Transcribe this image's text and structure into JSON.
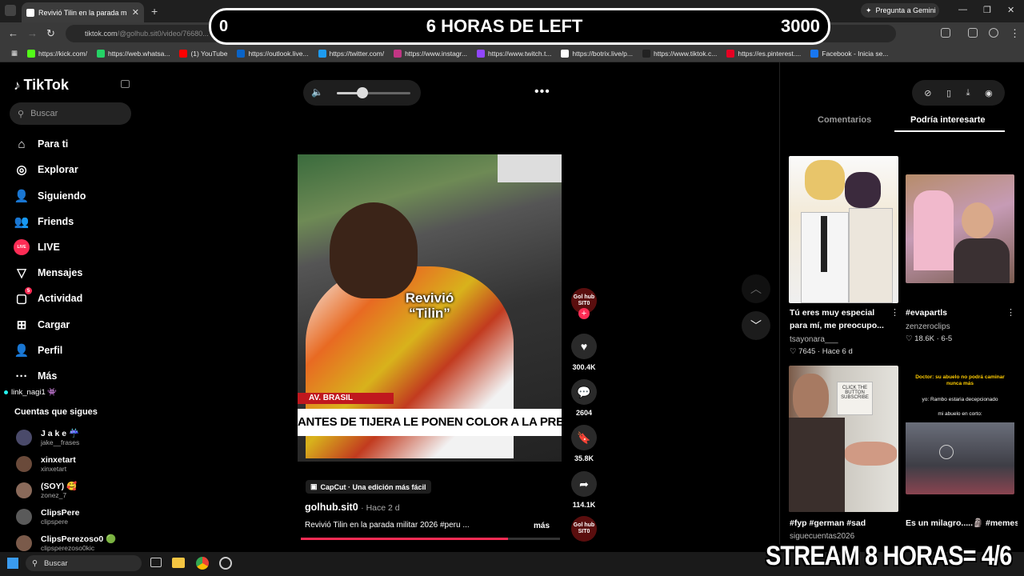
{
  "browser": {
    "tab_title": "Revivió Tilin en la parada m",
    "url_host": "tiktok.com",
    "url_path": "/@golhub.sit0/video/76680... 4600142083",
    "gemini": "Pregunta a Gemini",
    "bookmarks": [
      {
        "label": "https://kick.com/",
        "color": "#53fc18"
      },
      {
        "label": "https://web.whatsa...",
        "color": "#25d366"
      },
      {
        "label": "(1) YouTube",
        "color": "#ff0000"
      },
      {
        "label": "https://outlook.live...",
        "color": "#0a64c8"
      },
      {
        "label": "https://twitter.com/",
        "color": "#1d9bf0"
      },
      {
        "label": "https://www.instagr...",
        "color": "#c13584"
      },
      {
        "label": "https://www.twitch.t...",
        "color": "#9146ff"
      },
      {
        "label": "https://botrix.live/p...",
        "color": "#ffffff"
      },
      {
        "label": "https://www.tiktok.c...",
        "color": "#222222"
      },
      {
        "label": "https://es.pinterest....",
        "color": "#e60023"
      },
      {
        "label": "Facebook - Inicia se...",
        "color": "#1877f2"
      }
    ]
  },
  "overlay": {
    "left": "0",
    "center": "6 HORAS DE LEFT",
    "right": "3000"
  },
  "sidebar": {
    "logo": "TikTok",
    "search_placeholder": "Buscar",
    "nav": [
      {
        "label": "Para ti",
        "icon": "home-icon"
      },
      {
        "label": "Explorar",
        "icon": "compass-icon"
      },
      {
        "label": "Siguiendo",
        "icon": "following-icon"
      },
      {
        "label": "Friends",
        "icon": "friends-icon"
      },
      {
        "label": "LIVE",
        "icon": "live-icon"
      },
      {
        "label": "Mensajes",
        "icon": "messages-icon"
      },
      {
        "label": "Actividad",
        "icon": "activity-icon",
        "badge": "5"
      },
      {
        "label": "Cargar",
        "icon": "upload-icon"
      },
      {
        "label": "Perfil",
        "icon": "profile-icon"
      },
      {
        "label": "Más",
        "icon": "more-icon"
      }
    ],
    "live_user": "link_nagi1 👾",
    "following_header": "Cuentas que sigues",
    "accounts": [
      {
        "name": "J a k e ☔",
        "handle": "jake__frases"
      },
      {
        "name": "xinxetart",
        "handle": "xinxetart"
      },
      {
        "name": "(SOY) 🥰",
        "handle": "zonez_7"
      },
      {
        "name": "ClipsPere",
        "handle": "clipspere"
      },
      {
        "name": "ClipsPerezoso0 🟢",
        "handle": "clipsperezoso0kic"
      }
    ]
  },
  "video": {
    "caption_line1": "Revivió",
    "caption_line2": "“Tilin”",
    "location_tag": "AV. BRASIL",
    "ticker": "ANTES DE TIJERA LE PONEN COLOR A LA PREVIA DE",
    "volume": 0.35,
    "progress": 0.8,
    "capcut": "CapCut · Una edición más fácil",
    "author": "golhub.sit0",
    "time_ago": "Hace 2 d",
    "description": "Revivió Tilin en la parada militar 2026 #peru ...",
    "more": "más",
    "avatar_text": "Gol hub SIT0",
    "likes": "300.4K",
    "comments": "2604",
    "saves": "35.8K",
    "shares": "114.1K"
  },
  "right_panel": {
    "tab_comments": "Comentarios",
    "tab_suggested": "Podría interesarte",
    "items": [
      {
        "title": "Tú eres muy especial para mí, me preocupo...",
        "user": "tsayonara___",
        "stats": "♡ 7645 · Hace 6 d"
      },
      {
        "title": "#evapartls",
        "user": "zenzeroclips",
        "stats": "♡ 18.6K · 6-5"
      },
      {
        "title": "#fyp #german #sad",
        "user": "siguecuentas2026"
      },
      {
        "title": "Es un milagro.....🗿 #memesbaki #animes...",
        "user": ""
      }
    ],
    "thumb4_top": "Doctor: su abuelo no podrá caminar nunca más",
    "thumb4_mid": "yo: Rambo estaria decepcionado",
    "thumb4_low": "mi abuelo en corto:",
    "thumb3_sign": "CLICK THE BUTTON SUBSCRIBE"
  },
  "taskbar": {
    "search": "Buscar"
  },
  "stream_banner": "STREAM 8 HORAS= 4/6"
}
